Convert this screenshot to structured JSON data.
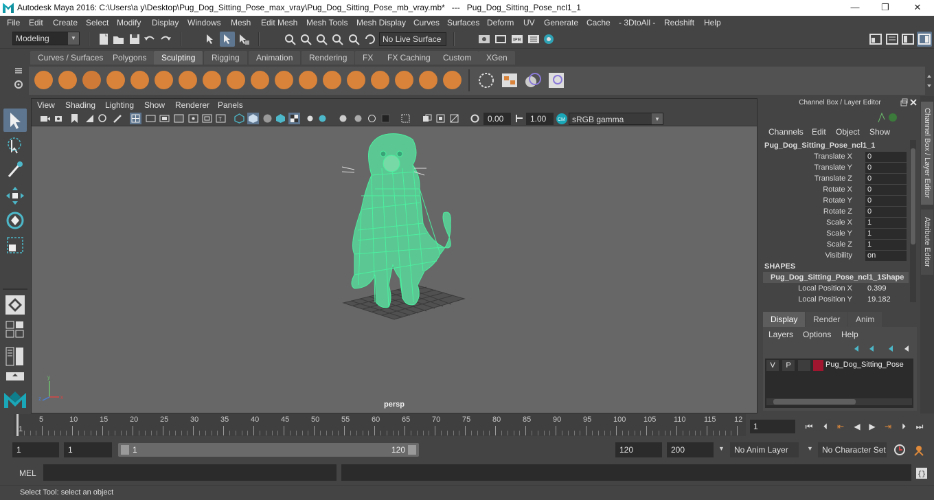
{
  "window": {
    "title": "Autodesk Maya 2016: C:\\Users\\a y\\Desktop\\Pug_Dog_Sitting_Pose_max_vray\\Pug_Dog_Sitting_Pose_mb_vray.mb*   ---   Pug_Dog_Sitting_Pose_ncl1_1",
    "minimize": "—",
    "maximize": "❐",
    "close": "✕"
  },
  "menubar": [
    "File",
    "Edit",
    "Create",
    "Select",
    "Modify",
    "Display",
    "Windows",
    "Mesh",
    "Edit Mesh",
    "Mesh Tools",
    "Mesh Display",
    "Curves",
    "Surfaces",
    "Deform",
    "UV",
    "Generate",
    "Cache",
    "- 3DtoAll -",
    "Redshift",
    "Help"
  ],
  "statusline": {
    "mode": "Modeling",
    "live_surface": "No Live Surface"
  },
  "shelf_tabs": [
    "Curves / Surfaces",
    "Polygons",
    "Sculpting",
    "Rigging",
    "Animation",
    "Rendering",
    "FX",
    "FX Caching",
    "Custom",
    "XGen"
  ],
  "active_shelf_tab": "Sculpting",
  "viewport": {
    "menu": [
      "View",
      "Shading",
      "Lighting",
      "Show",
      "Renderer",
      "Panels"
    ],
    "exposure": "0.00",
    "gamma": "1.00",
    "color_space": "sRGB gamma",
    "camera": "persp"
  },
  "channel_box": {
    "title": "Channel Box / Layer Editor",
    "menu": [
      "Channels",
      "Edit",
      "Object",
      "Show"
    ],
    "object": "Pug_Dog_Sitting_Pose_ncl1_1",
    "channels": [
      {
        "label": "Translate X",
        "value": "0"
      },
      {
        "label": "Translate Y",
        "value": "0"
      },
      {
        "label": "Translate Z",
        "value": "0"
      },
      {
        "label": "Rotate X",
        "value": "0"
      },
      {
        "label": "Rotate Y",
        "value": "0"
      },
      {
        "label": "Rotate Z",
        "value": "0"
      },
      {
        "label": "Scale X",
        "value": "1"
      },
      {
        "label": "Scale Y",
        "value": "1"
      },
      {
        "label": "Scale Z",
        "value": "1"
      },
      {
        "label": "Visibility",
        "value": "on"
      }
    ],
    "shapes_header": "SHAPES",
    "shape_name": "Pug_Dog_Sitting_Pose_ncl1_1Shape",
    "shape_channels": [
      {
        "label": "Local Position X",
        "value": "0.399"
      },
      {
        "label": "Local Position Y",
        "value": "19.182"
      }
    ]
  },
  "layer_editor": {
    "tabs": [
      "Display",
      "Render",
      "Anim"
    ],
    "active_tab": "Display",
    "menu": [
      "Layers",
      "Options",
      "Help"
    ],
    "layer": {
      "v": "V",
      "p": "P",
      "name": "Pug_Dog_Sitting_Pose",
      "color": "#a0162e"
    }
  },
  "side_tabs": [
    "Channel Box / Layer Editor",
    "Attribute Editor"
  ],
  "timeslider": {
    "labels": [
      "1",
      "5",
      "10",
      "15",
      "20",
      "25",
      "30",
      "35",
      "40",
      "45",
      "50",
      "55",
      "60",
      "65",
      "70",
      "75",
      "80",
      "85",
      "90",
      "95",
      "100",
      "105",
      "110",
      "115",
      "12"
    ],
    "current_frame": "1"
  },
  "range": {
    "start": "1",
    "playback_start": "1",
    "slider_start": "1",
    "slider_end": "120",
    "playback_end": "120",
    "end": "200",
    "anim_layer": "No Anim Layer",
    "character_set": "No Character Set"
  },
  "command": {
    "label": "MEL"
  },
  "help_line": "Select Tool: select an object",
  "colors": {
    "accent": "#5e768f",
    "shelf_icon": "#d8823a",
    "wireframe": "#4cf0a0",
    "layer_color": "#a0162e"
  }
}
